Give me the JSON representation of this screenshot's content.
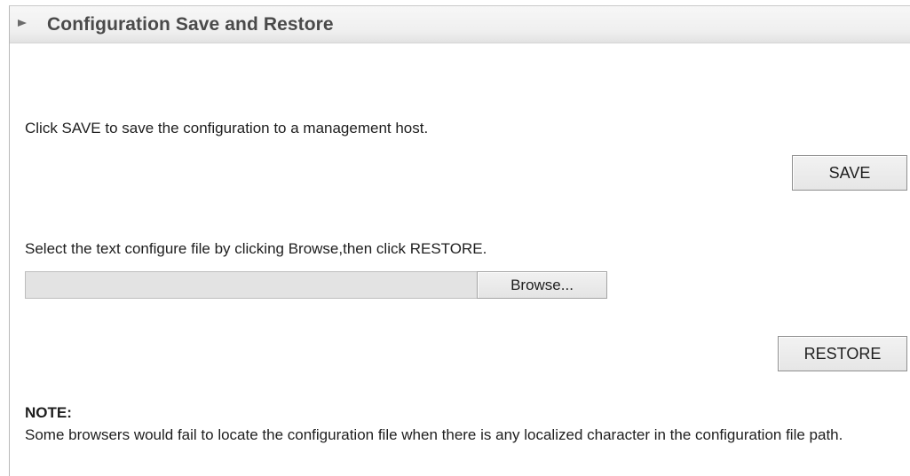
{
  "panel": {
    "title": "Configuration Save and Restore",
    "collapse_icon": "triangle-right-icon"
  },
  "save_section": {
    "instruction": "Click SAVE to save the configuration to a management host.",
    "save_label": "SAVE"
  },
  "restore_section": {
    "instruction": "Select the text configure file by clicking Browse,then click RESTORE.",
    "file_value": "",
    "browse_label": "Browse...",
    "restore_label": "RESTORE"
  },
  "note": {
    "title": "NOTE:",
    "body": "Some browsers would fail to locate the configuration file when there is any localized character in the configuration file path."
  },
  "colors": {
    "header_title": "#4a4a4a",
    "text": "#1e1e1e",
    "field_background": "#e3e3e3"
  }
}
